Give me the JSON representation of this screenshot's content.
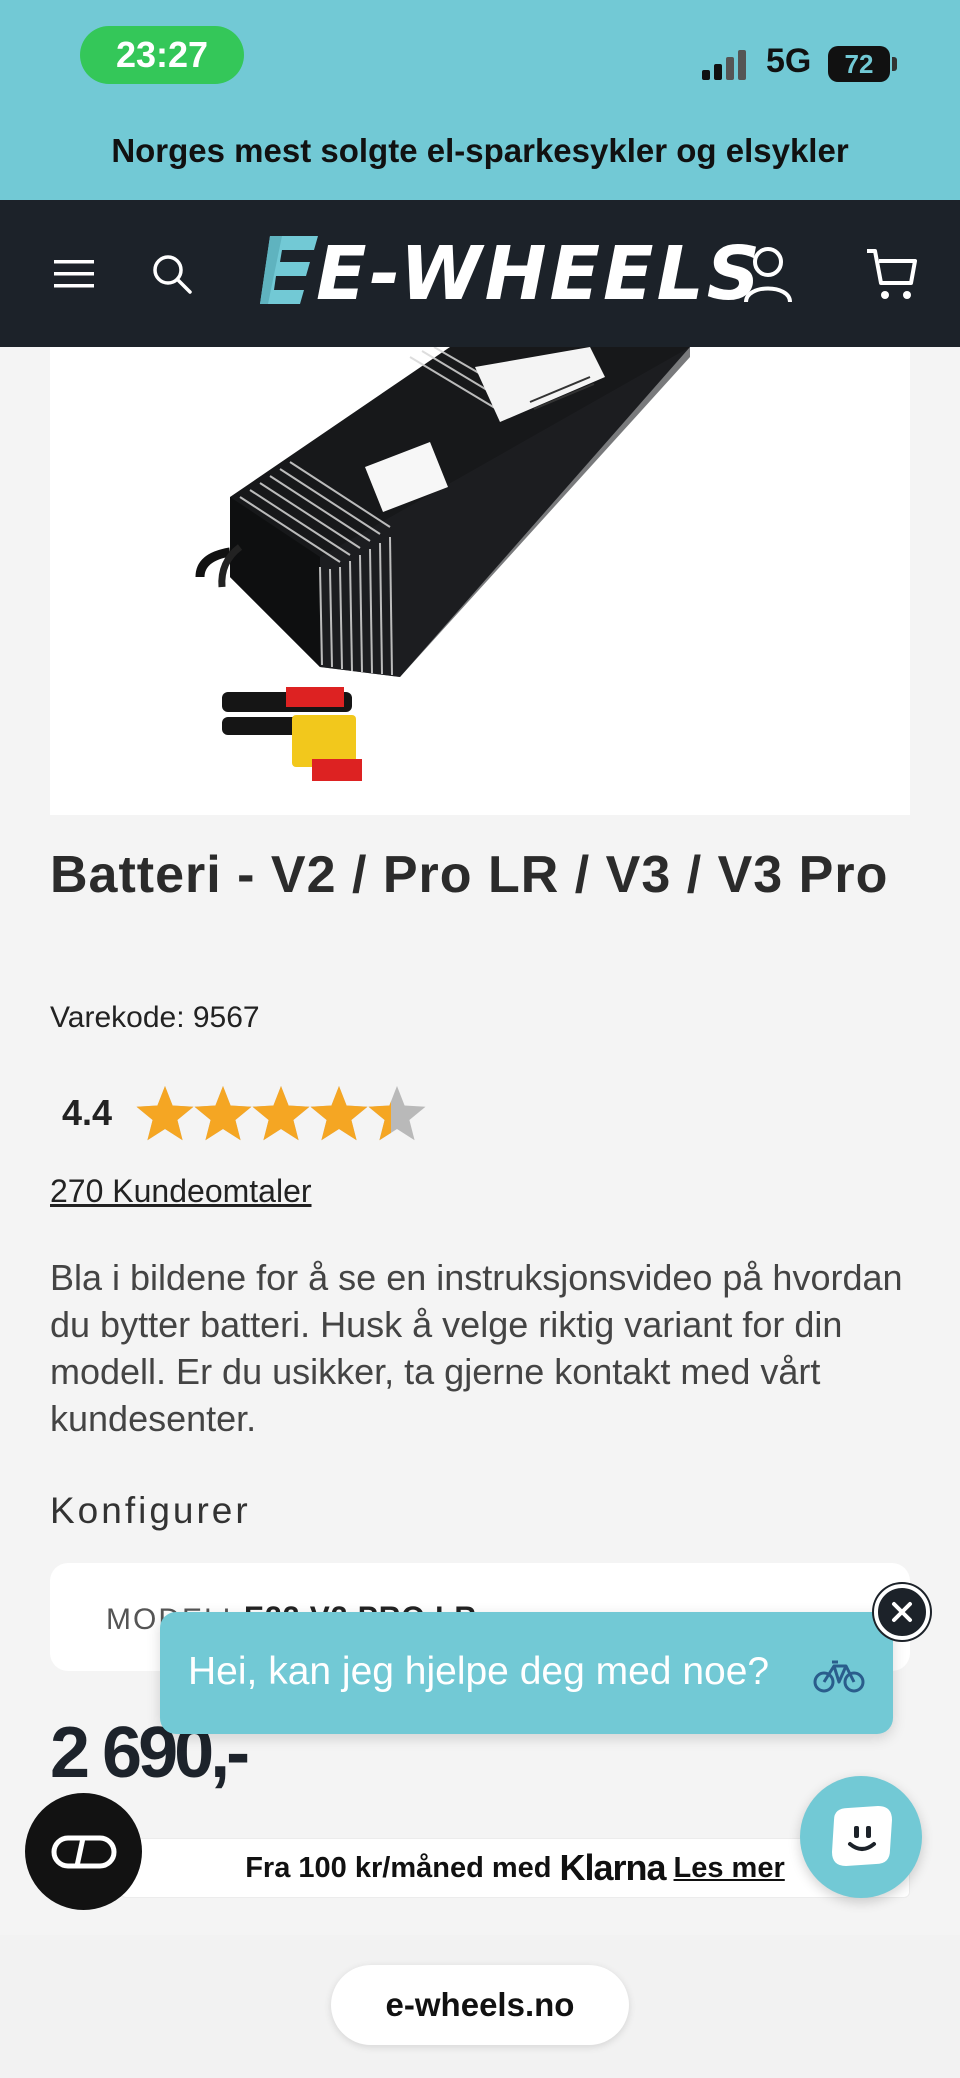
{
  "status_bar": {
    "time": "23:27",
    "network": "5G",
    "battery": "72"
  },
  "banner": {
    "tagline": "Norges mest solgte el-sparkesykler og elsykler"
  },
  "nav": {
    "logo_text": "E-WHEELS",
    "icons": [
      "menu-icon",
      "search-icon",
      "user-icon",
      "cart-icon"
    ]
  },
  "product": {
    "title": "Batteri - V2 / Pro LR / V3 / V3 Pro",
    "sku": "Varekode: 9567",
    "rating": "4.4",
    "rating_value": 4.4,
    "rating_max": 5,
    "reviews": "270 Kundeomtaler",
    "description": "Bla i bildene for å se en instruksjonsvideo på hvordan du bytter batteri. Husk å velge riktig variant for din modell. Er du usikker, ta gjerne kontakt med vårt kundesenter.",
    "config_title": "Konfigurer",
    "config_label": "MODELL",
    "config_value": "E22 V2 PRO LR",
    "price": "2 690,-"
  },
  "klarna": {
    "prefix": "Fra 100 kr/måned med",
    "brand": "Klarna",
    "link": "Les mer"
  },
  "chat": {
    "message": "Hei, kan jeg hjelpe deg med noe?"
  },
  "browser": {
    "url": "e-wheels.no"
  },
  "colors": {
    "accent": "#72c9d5",
    "dark": "#1c2229",
    "star": "#f5a623"
  }
}
